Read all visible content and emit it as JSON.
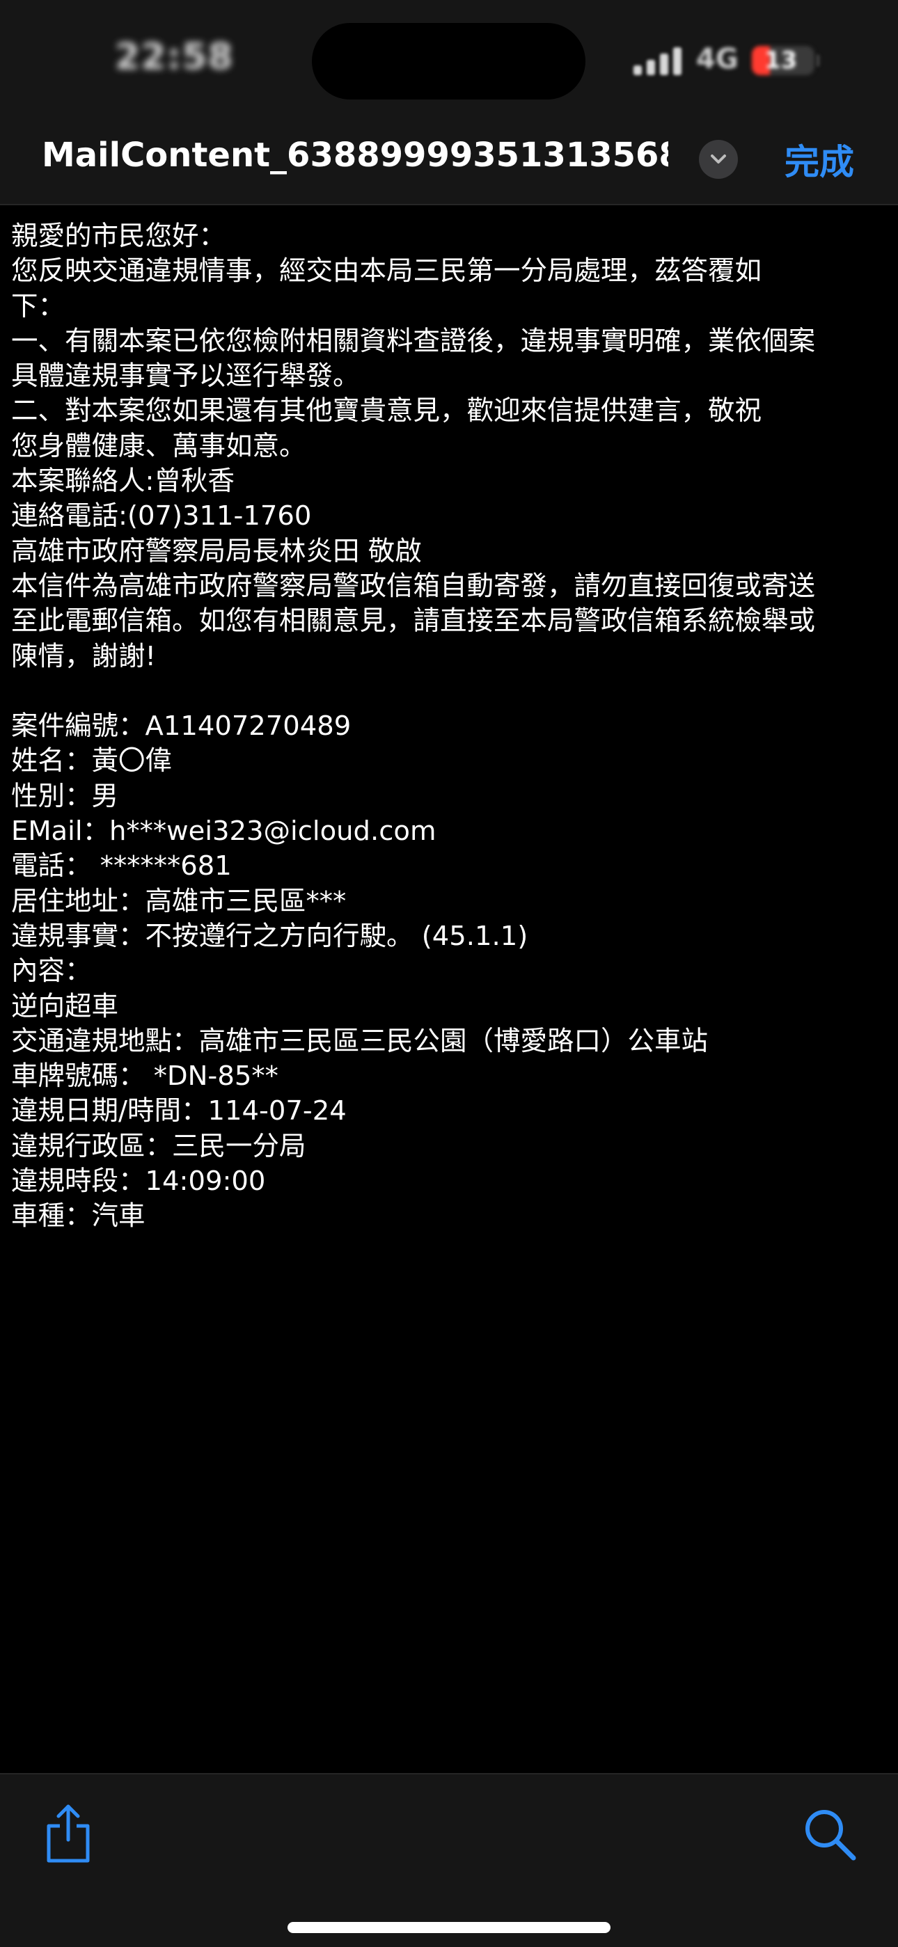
{
  "status_bar": {
    "time": "22:58",
    "network": "4G",
    "battery_level": "13",
    "battery_color": "#ff3b30"
  },
  "nav": {
    "title": "MailContent_63889999351313568...",
    "done_label": "完成",
    "accent_color": "#2f8cf5"
  },
  "content": {
    "lines": [
      "親愛的市民您好：",
      "您反映交通違規情事，經交由本局三民第一分局處理，茲答覆如",
      "下：",
      "一、有關本案已依您檢附相關資料查證後，違規事實明確，業依個案",
      "具體違規事實予以逕行舉發。",
      "二、對本案您如果還有其他寶貴意見，歡迎來信提供建言，敬祝",
      "您身體健康、萬事如意。",
      "本案聯絡人:曾秋香",
      "連絡電話:(07)311-1760",
      "高雄市政府警察局局長林炎田 敬啟",
      "本信件為高雄市政府警察局警政信箱自動寄發，請勿直接回復或寄送",
      "至此電郵信箱。如您有相關意見，請直接至本局警政信箱系統檢舉或",
      "陳情，謝謝!",
      "",
      "案件編號：A11407270489",
      "姓名：黃〇偉",
      "性別：男",
      "EMail：h***wei323@icloud.com",
      "電話： ******681",
      "居住地址：高雄市三民區***",
      "違規事實：不按遵行之方向行駛。 (45.1.1)",
      "內容：",
      "逆向超車",
      "交通違規地點：高雄市三民區三民公園（博愛路口）公車站",
      "車牌號碼： *DN-85**",
      "違規日期/時間：114-07-24",
      "違規行政區：三民一分局",
      "違規時段：14:09:00",
      "車種：汽車"
    ]
  },
  "toolbar": {
    "left_icon": "share-icon",
    "right_icon": "search-icon"
  }
}
